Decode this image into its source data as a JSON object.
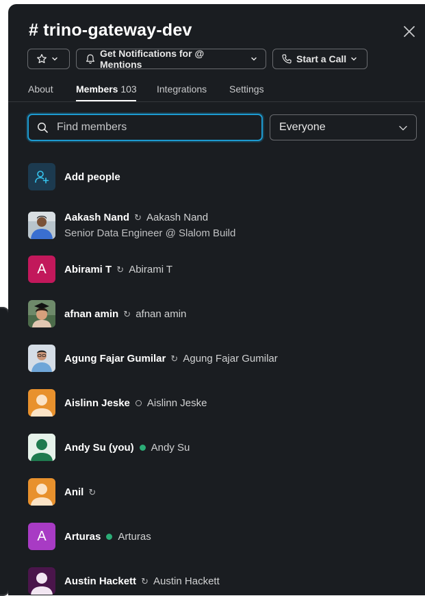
{
  "channel": {
    "title": "# trino-gateway-dev"
  },
  "toolbar": {
    "notifications_label": "Get Notifications for @ Mentions",
    "call_label": "Start a Call"
  },
  "tabs": {
    "about": "About",
    "members": "Members",
    "members_count": "103",
    "integrations": "Integrations",
    "settings": "Settings"
  },
  "search": {
    "placeholder": "Find members"
  },
  "filter": {
    "selected": "Everyone"
  },
  "add_people": {
    "label": "Add people"
  },
  "members": [
    {
      "name": "Aakash Nand",
      "status": "dnd",
      "display_name": "Aakash Nand",
      "title": "Senior Data Engineer @ Slalom Build",
      "avatar": "photo-man-blue-shirt"
    },
    {
      "name": "Abirami T",
      "status": "dnd",
      "display_name": "Abirami T",
      "avatar_letter": "A",
      "avatar_color": "#c2185b"
    },
    {
      "name": "afnan amin",
      "status": "dnd",
      "display_name": "afnan amin",
      "avatar": "photo-graduate"
    },
    {
      "name": "Agung Fajar Gumilar",
      "status": "dnd",
      "display_name": "Agung Fajar Gumilar",
      "avatar": "photo-man-glasses"
    },
    {
      "name": "Aislinn Jeske",
      "status": "away",
      "display_name": "Aislinn Jeske",
      "avatar": "default-orange"
    },
    {
      "name": "Andy Su (you)",
      "status": "active",
      "display_name": "Andy Su",
      "avatar": "default-green"
    },
    {
      "name": "Anil",
      "status": "dnd",
      "display_name": "",
      "avatar": "default-orange"
    },
    {
      "name": "Arturas",
      "status": "active",
      "display_name": "Arturas",
      "avatar_letter": "A",
      "avatar_color": "#a83bc4"
    },
    {
      "name": "Austin Hackett",
      "status": "dnd",
      "display_name": "Austin Hackett",
      "avatar": "default-purple"
    }
  ],
  "colors": {
    "background": "#1a1d21",
    "focus_ring": "#1d9bd1",
    "active_dot": "#2bac76",
    "avatar_orange": "#e8912d",
    "avatar_green": "#1f7a4f",
    "avatar_purple": "#4a154b"
  }
}
